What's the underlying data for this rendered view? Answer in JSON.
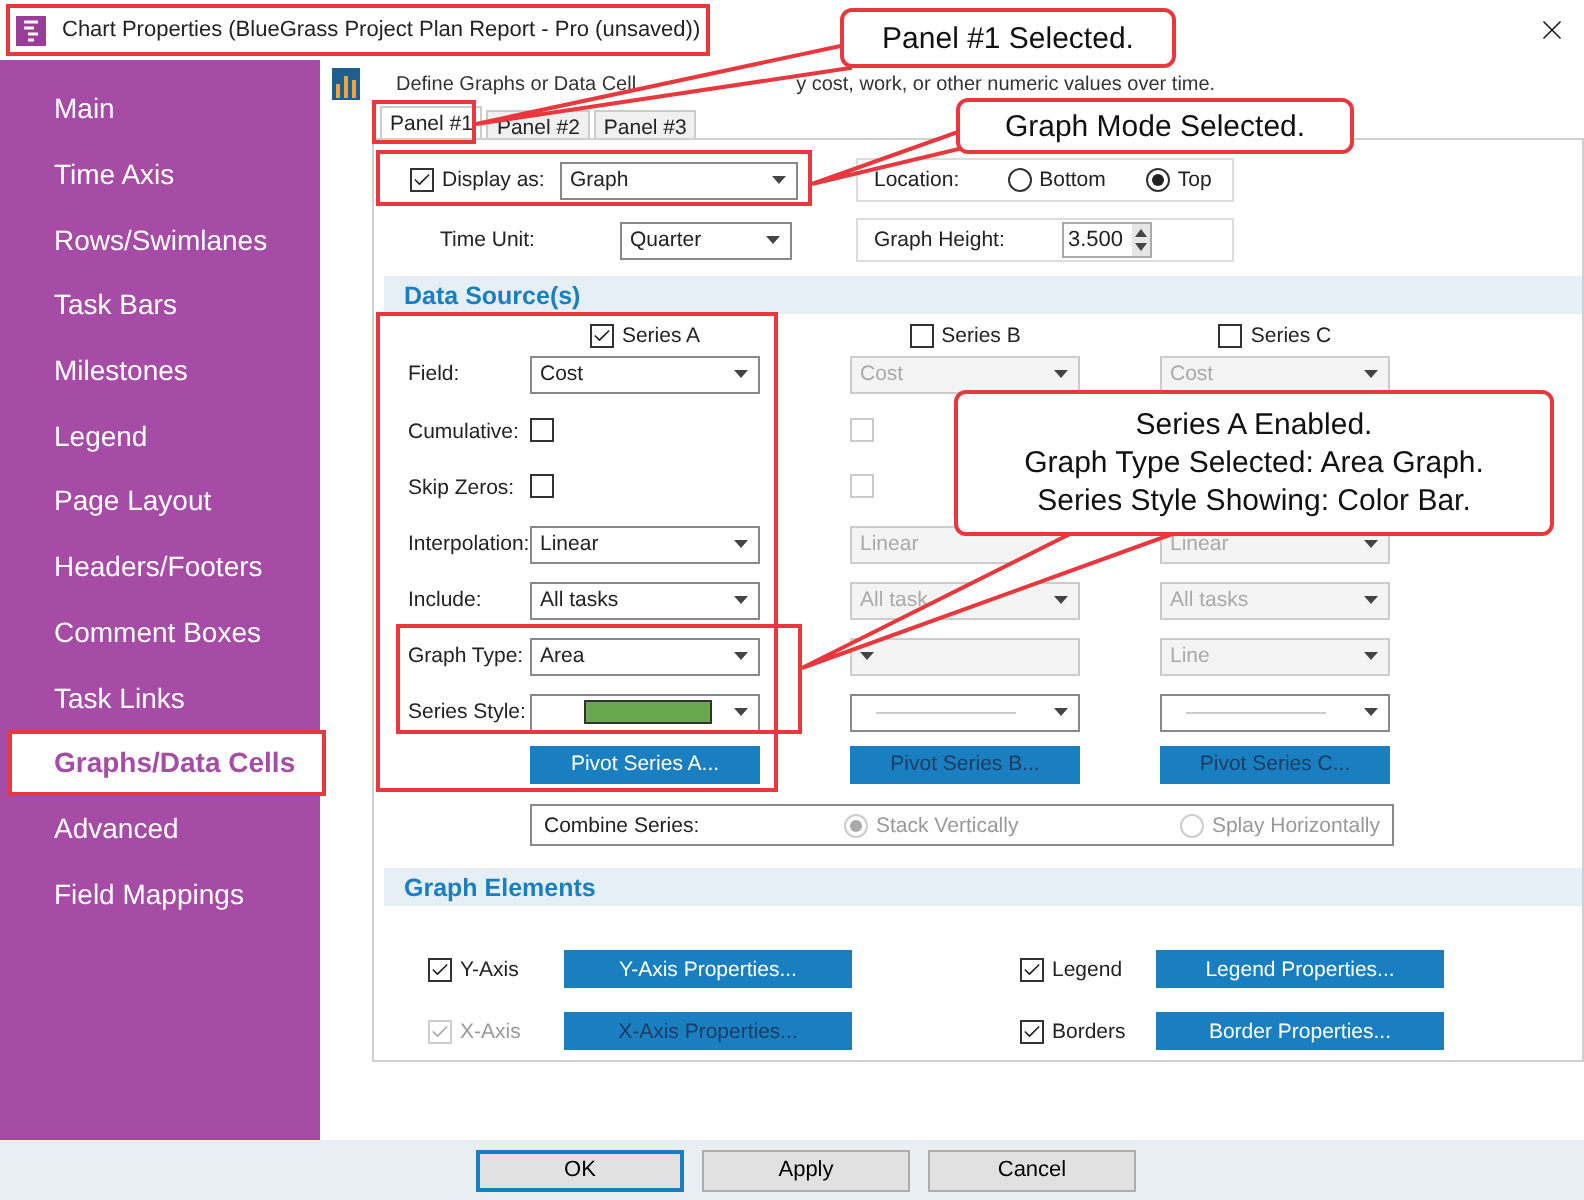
{
  "window": {
    "title": "Chart Properties (BlueGrass Project Plan Report - Pro (unsaved))"
  },
  "sidebar": {
    "items": [
      {
        "label": "Main",
        "selected": false
      },
      {
        "label": "Time Axis",
        "selected": false
      },
      {
        "label": "Rows/Swimlanes",
        "selected": false
      },
      {
        "label": "Task Bars",
        "selected": false
      },
      {
        "label": "Milestones",
        "selected": false
      },
      {
        "label": "Legend",
        "selected": false
      },
      {
        "label": "Page Layout",
        "selected": false
      },
      {
        "label": "Headers/Footers",
        "selected": false
      },
      {
        "label": "Comment Boxes",
        "selected": false
      },
      {
        "label": "Task Links",
        "selected": false
      },
      {
        "label": "Graphs/Data Cells",
        "selected": true
      },
      {
        "label": "Advanced",
        "selected": false
      },
      {
        "label": "Field Mappings",
        "selected": false
      }
    ]
  },
  "description": [
    "Define Graphs or Data Cell",
    "y cost, work, or other numeric values over time."
  ],
  "tabs": [
    {
      "label": "Panel #1",
      "selected": true
    },
    {
      "label": "Panel #2",
      "selected": false
    },
    {
      "label": "Panel #3",
      "selected": false
    }
  ],
  "display": {
    "checked": true,
    "label": "Display as:",
    "value": "Graph"
  },
  "location": {
    "label": "Location:",
    "options": [
      {
        "label": "Bottom",
        "selected": false
      },
      {
        "label": "Top",
        "selected": true
      }
    ]
  },
  "time_unit": {
    "label": "Time Unit:",
    "value": "Quarter"
  },
  "graph_height": {
    "label": "Graph Height:",
    "value": "3.500"
  },
  "data_source": {
    "title": "Data Source(s)",
    "row_labels": [
      "Field:",
      "Cumulative:",
      "Skip Zeros:",
      "Interpolation:",
      "Include:",
      "Graph Type:",
      "Series Style:"
    ],
    "series": [
      {
        "name": "Series A",
        "checked": true,
        "disabled": false,
        "field": "Cost",
        "cumulative": false,
        "skip_zeros": false,
        "interpolation": "Linear",
        "include": "All tasks",
        "graph_type": "Area",
        "style": {
          "kind": "color_bar",
          "color": "#6aa84f"
        },
        "pivot": "Pivot Series A..."
      },
      {
        "name": "Series B",
        "checked": false,
        "disabled": true,
        "field": "Cost",
        "cumulative": false,
        "skip_zeros": false,
        "interpolation": "Linear",
        "include": "All task",
        "style": {
          "kind": "line"
        },
        "pivot": "Pivot Series B..."
      },
      {
        "name": "Series C",
        "checked": false,
        "disabled": true,
        "field": "Cost",
        "interpolation": "Linear",
        "include": "All tasks",
        "graph_type": "Line",
        "style": {
          "kind": "line"
        },
        "pivot": "Pivot Series C..."
      }
    ],
    "combine": {
      "label": "Combine Series:",
      "disabled": true,
      "options": [
        {
          "label": "Stack Vertically",
          "selected": true
        },
        {
          "label": "Splay Horizontally",
          "selected": false
        }
      ]
    }
  },
  "graph_elements": {
    "title": "Graph Elements",
    "items": [
      {
        "label": "Y-Axis",
        "checked": true,
        "disabled": false,
        "button": "Y-Axis Properties...",
        "button_disabled": false
      },
      {
        "label": "Legend",
        "checked": true,
        "disabled": false,
        "button": "Legend Properties...",
        "button_disabled": false
      },
      {
        "label": "X-Axis",
        "checked": true,
        "disabled": true,
        "button": "X-Axis Properties...",
        "button_disabled": true
      },
      {
        "label": "Borders",
        "checked": true,
        "disabled": false,
        "button": "Border Properties...",
        "button_disabled": false
      }
    ]
  },
  "footer": {
    "buttons": [
      {
        "label": "OK",
        "default": true
      },
      {
        "label": "Apply",
        "default": false
      },
      {
        "label": "Cancel",
        "default": false
      }
    ]
  },
  "callouts": [
    {
      "lines": [
        "Panel #1 Selected."
      ]
    },
    {
      "lines": [
        "Graph Mode Selected."
      ]
    },
    {
      "lines": [
        "Series A Enabled.",
        "Graph Type Selected: Area Graph.",
        "Series Style Showing: Color Bar."
      ]
    }
  ]
}
